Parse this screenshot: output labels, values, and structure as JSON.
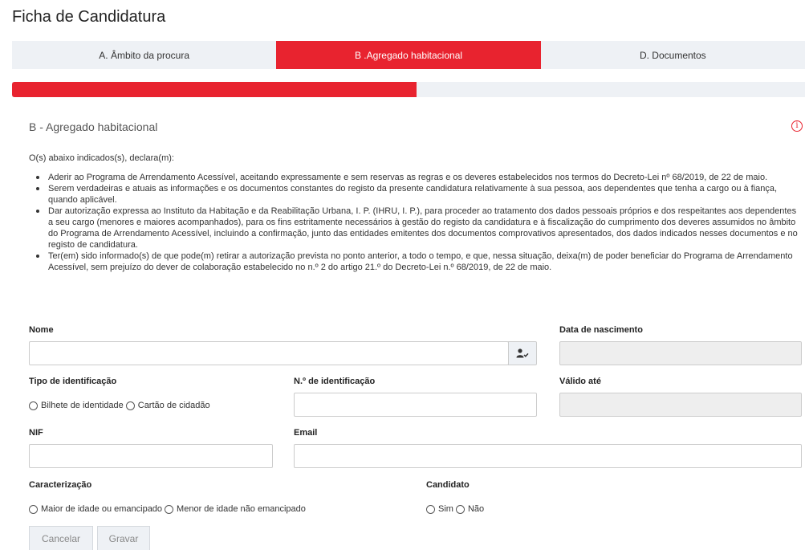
{
  "page": {
    "title": "Ficha de Candidatura"
  },
  "tabs": [
    {
      "label": "A. Âmbito da procura",
      "active": false
    },
    {
      "label": "B .Agregado habitacional",
      "active": true
    },
    {
      "label": "D. Documentos",
      "active": false
    }
  ],
  "progress": {
    "value": 0.51,
    "color": "#e8232f"
  },
  "section": {
    "title": "B - Agregado habitacional",
    "info_icon": "info-circle-icon",
    "intro": "O(s) abaixo indicados(s), declara(m):",
    "declarations": [
      "Aderir ao Programa de Arrendamento Acessível, aceitando expressamente e sem reservas as regras e os deveres estabelecidos nos termos do Decreto-Lei nº 68/2019, de 22 de maio.",
      "Serem verdadeiras e atuais as informações e os documentos constantes do registo da presente candidatura relativamente à sua pessoa, aos dependentes que tenha a cargo ou à fiança, quando aplicável.",
      "Dar autorização expressa ao Instituto da Habitação e da Reabilitação Urbana, I. P. (IHRU, I. P.), para proceder ao tratamento dos dados pessoais próprios e dos respeitantes aos dependentes a seu cargo (menores e maiores acompanhados), para os fins estritamente necessários à gestão do registo da candidatura e à fiscalização do cumprimento dos deveres assumidos no âmbito do Programa de Arrendamento Acessível, incluindo a confirmação, junto das entidades emitentes dos documentos comprovativos apresentados, dos dados indicados nesses documentos e no registo de candidatura.",
      "Ter(em) sido informado(s) de que pode(m) retirar a autorização prevista no ponto anterior, a todo o tempo, e que, nessa situação, deixa(m) de poder beneficiar do Programa de Arrendamento Acessível, sem prejuízo do dever de colaboração estabelecido no n.º 2 do artigo 21.º do Decreto-Lei n.º 68/2019, de 22 de maio."
    ]
  },
  "form": {
    "nome": {
      "label": "Nome",
      "value": "",
      "addon_icon": "user-check-icon"
    },
    "data_nascimento": {
      "label": "Data de nascimento",
      "value": ""
    },
    "tipo_identificacao": {
      "label": "Tipo de identificação",
      "options": [
        "Bilhete de identidade",
        "Cartão de cidadão"
      ]
    },
    "num_identificacao": {
      "label": "N.º de identificação",
      "value": ""
    },
    "valido_ate": {
      "label": "Válido até",
      "value": ""
    },
    "nif": {
      "label": "NIF",
      "value": ""
    },
    "email": {
      "label": "Email",
      "value": ""
    },
    "caracterizacao": {
      "label": "Caracterização",
      "options": [
        "Maior de idade ou emancipado",
        "Menor de idade não emancipado"
      ]
    },
    "candidato": {
      "label": "Candidato",
      "options": [
        "Sim",
        "Não"
      ]
    }
  },
  "buttons": {
    "cancel": "Cancelar",
    "save": "Gravar"
  }
}
